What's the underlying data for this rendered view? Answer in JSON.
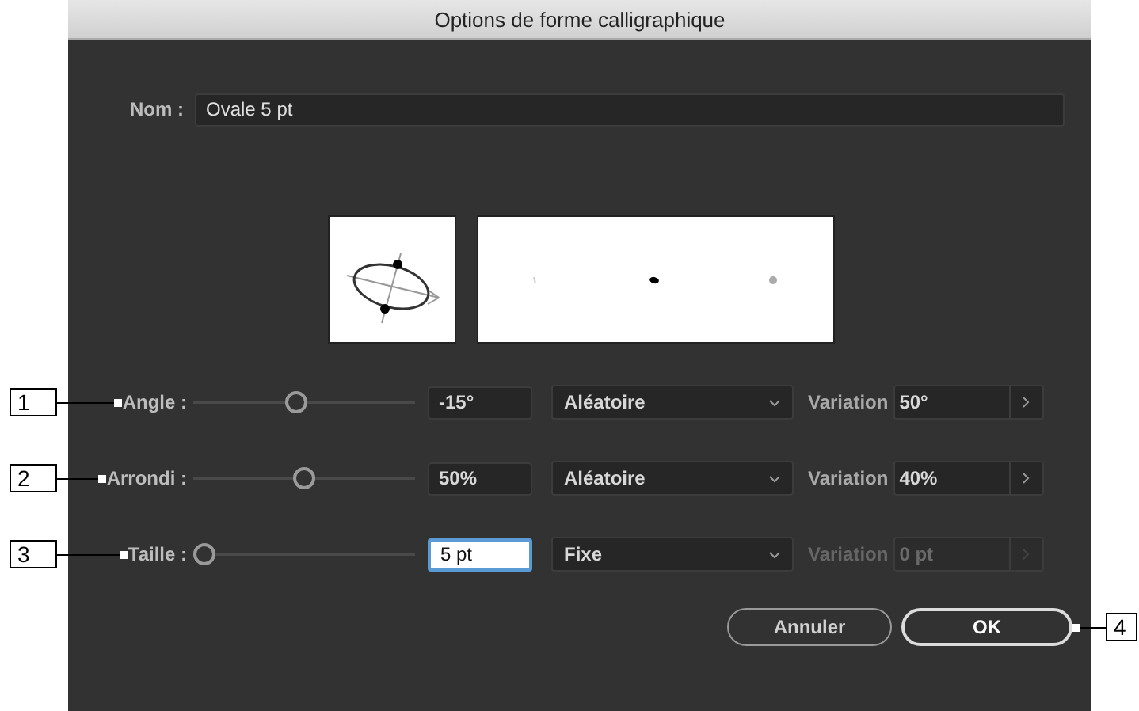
{
  "window": {
    "title": "Options de forme calligraphique"
  },
  "name_field": {
    "label": "Nom :",
    "value": "Ovale 5 pt"
  },
  "rows": [
    {
      "callout": "1",
      "label": "Angle :",
      "level": 0.46,
      "value": "-15°",
      "focused": false,
      "mode": "Aléatoire",
      "variation_label": "Variation",
      "variation": "50°",
      "disabled": false
    },
    {
      "callout": "2",
      "label": "Arrondi :",
      "level": 0.5,
      "value": "50%",
      "focused": false,
      "mode": "Aléatoire",
      "variation_label": "Variation",
      "variation": "40%",
      "disabled": false
    },
    {
      "callout": "3",
      "label": "Taille :",
      "level": 0,
      "value": "5 pt",
      "focused": true,
      "mode": "Fixe",
      "variation_label": "Variation",
      "variation": "0 pt",
      "disabled": true
    }
  ],
  "buttons": [
    {
      "label": "Annuler",
      "kind": "cancel"
    },
    {
      "label": "OK",
      "kind": "default",
      "callout": "4"
    }
  ]
}
